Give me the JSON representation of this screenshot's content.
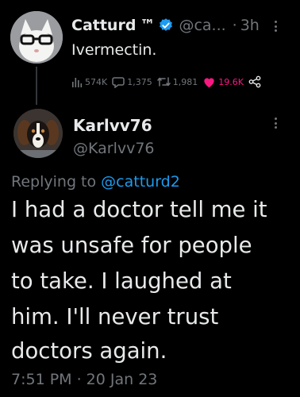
{
  "parent_tweet": {
    "display_name": "Catturd",
    "trademark": "™",
    "handle": "@ca...",
    "separator": "·",
    "time_ago": "3h",
    "text": "Ivermectin.",
    "views": "574K",
    "replies": "1,375",
    "retweets": "1,981",
    "likes": "19.6K"
  },
  "main_tweet": {
    "display_name": "Karlvv76",
    "handle": "@Karlvv76",
    "replying_prefix": "Replying to",
    "replying_to": "@catturd2",
    "body_lines": [
      "I had a doctor tell me it",
      "was unsafe for people",
      "to take. I laughed at",
      "him. I'll never trust",
      "doctors again."
    ],
    "timestamp": "7:51 PM · 20 Jan 23"
  },
  "colors": {
    "background": "#000000",
    "primary_text": "#e7e9ea",
    "secondary_text": "#71767b",
    "accent_blue": "#1d9bf0",
    "like_pink": "#f91880"
  },
  "icons": {
    "verified": "verified-badge-icon",
    "views": "bar-chart-icon",
    "reply": "speech-bubble-icon",
    "retweet": "retweet-icon",
    "like": "heart-filled-icon",
    "share": "share-nodes-icon",
    "more": "vertical-ellipsis-icon"
  }
}
